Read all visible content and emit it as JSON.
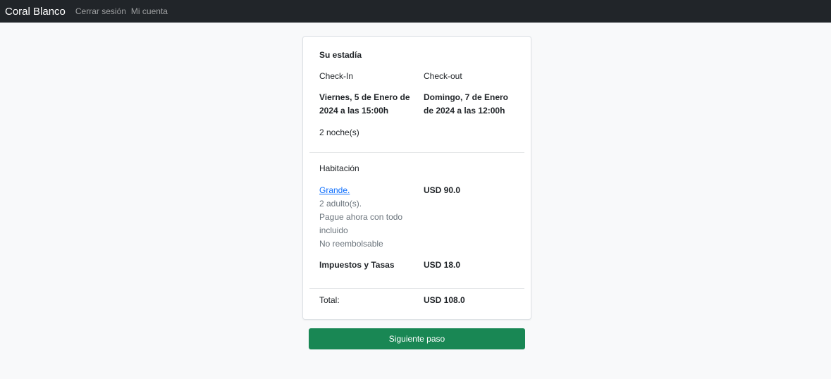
{
  "nav": {
    "brand": "Coral Blanco",
    "logout": "Cerrar sesión",
    "account": "Mi cuenta"
  },
  "stay": {
    "heading": "Su estadía",
    "checkin_label": "Check-In",
    "checkout_label": "Check-out",
    "checkin_line1": "Viernes, 5 de Enero de",
    "checkin_line2": "2024 a las 15:00h",
    "checkout_line1": "Domingo, 7 de Enero",
    "checkout_line2": "de 2024 a las 12:00h",
    "nights": "2 noche(s)"
  },
  "room": {
    "heading": "Habitación",
    "name": "Grande.",
    "price": "USD 90.0",
    "adults": "2 adulto(s).",
    "plan_line1": "Pague ahora con todo",
    "plan_line2": "incluido",
    "refund": "No reembolsable",
    "taxes_label": "Impuestos y Tasas",
    "taxes_value": "USD 18.0"
  },
  "total": {
    "label": "Total:",
    "value": "USD 108.0"
  },
  "actions": {
    "next": "Siguiente paso"
  },
  "colors": {
    "navbar": "#212529",
    "primary_button": "#198754",
    "link": "#0d6efd"
  }
}
